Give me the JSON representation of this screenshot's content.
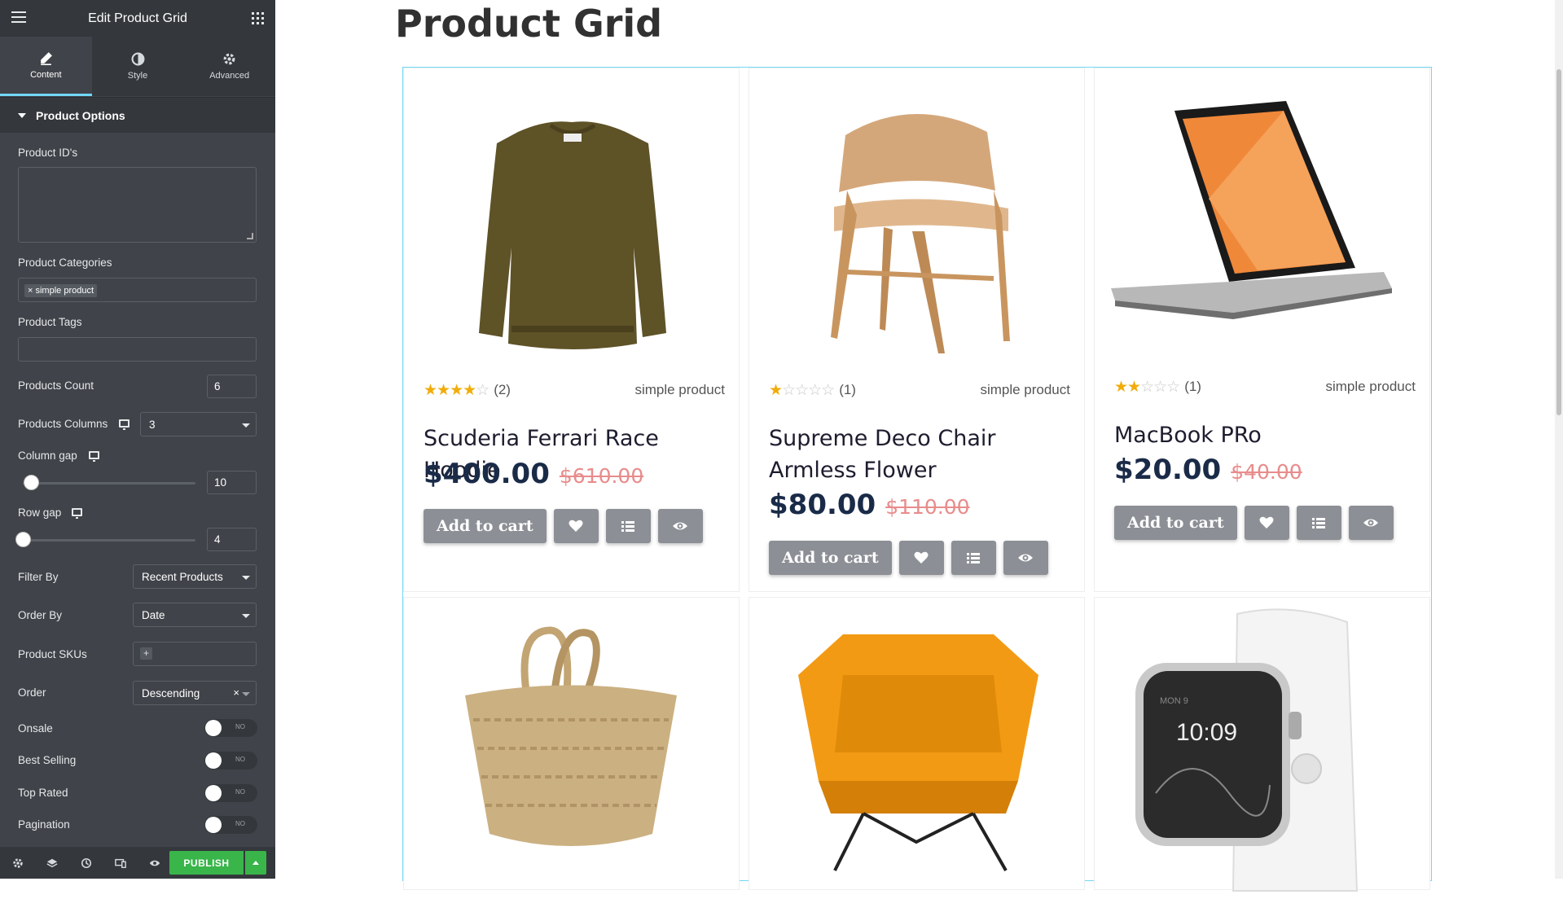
{
  "sidebar": {
    "title": "Edit Product Grid",
    "tabs": [
      {
        "label": "Content",
        "icon": "pencil-icon",
        "active": true
      },
      {
        "label": "Style",
        "icon": "contrast-icon",
        "active": false
      },
      {
        "label": "Advanced",
        "icon": "gear-icon",
        "active": false
      }
    ],
    "section_title": "Product Options",
    "fields": {
      "product_ids": {
        "label": "Product ID's",
        "value": ""
      },
      "product_categories": {
        "label": "Product Categories",
        "chip": "× simple product"
      },
      "product_tags": {
        "label": "Product Tags",
        "value": ""
      },
      "products_count": {
        "label": "Products Count",
        "value": "6"
      },
      "products_columns": {
        "label": "Products Columns",
        "value": "3"
      },
      "column_gap": {
        "label": "Column gap",
        "value": "10"
      },
      "row_gap": {
        "label": "Row gap",
        "value": "4"
      },
      "filter_by": {
        "label": "Filter By",
        "value": "Recent Products"
      },
      "order_by": {
        "label": "Order By",
        "value": "Date"
      },
      "product_skus": {
        "label": "Product SKUs",
        "add": "+"
      },
      "order": {
        "label": "Order",
        "value": "Descending",
        "clear": "×"
      },
      "onsale": {
        "label": "Onsale",
        "toggle": "NO"
      },
      "best_selling": {
        "label": "Best Selling",
        "toggle": "NO"
      },
      "top_rated": {
        "label": "Top Rated",
        "toggle": "NO"
      },
      "pagination": {
        "label": "Pagination",
        "toggle": "NO"
      }
    },
    "footer": {
      "icons": [
        "settings-icon",
        "layers-icon",
        "history-icon",
        "responsive-icon",
        "eye-icon"
      ],
      "publish_label": "PUBLISH"
    },
    "colors": {
      "panel": "#404349",
      "header": "#34383c",
      "accent": "#71d7f7",
      "publish": "#39b54a"
    }
  },
  "preview": {
    "page_title": "Product Grid",
    "products": [
      {
        "title": "Scuderia Ferrari Race Hoodie",
        "rating": 4,
        "reviews": "(2)",
        "category": "simple product",
        "price": "$400.00",
        "old_price": "$610.00",
        "cart_label": "Add to cart",
        "image": "sweater"
      },
      {
        "title": "Supreme Deco Chair Armless Flower",
        "rating": 1,
        "reviews": "(1)",
        "category": "simple product",
        "price": "$80.00",
        "old_price": "$110.00",
        "cart_label": "Add to cart",
        "image": "wooden-chair"
      },
      {
        "title": "MacBook PRo",
        "rating": 2,
        "reviews": "(1)",
        "category": "simple product",
        "price": "$20.00",
        "old_price": "$40.00",
        "cart_label": "Add to cart",
        "image": "laptop"
      },
      {
        "title": "",
        "image": "straw-basket"
      },
      {
        "title": "",
        "image": "orange-armchair"
      },
      {
        "title": "",
        "image": "smartwatch",
        "watch_date": "MON 9",
        "watch_time": "10:09"
      }
    ]
  }
}
